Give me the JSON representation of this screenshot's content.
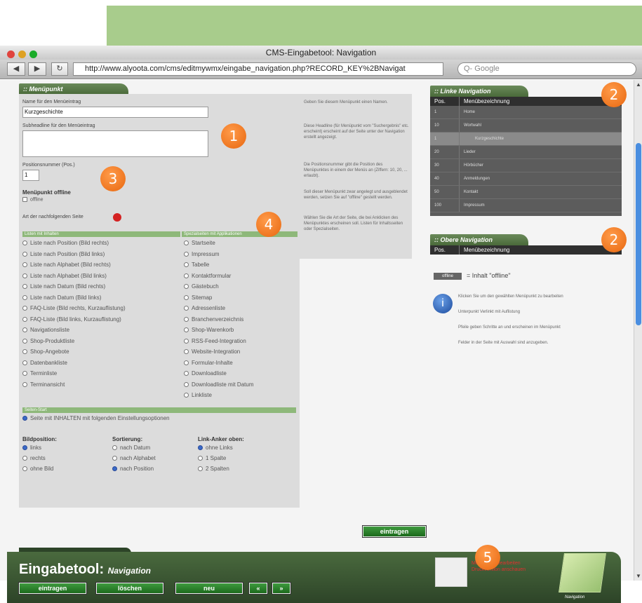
{
  "window": {
    "title": "CMS-Eingabetool: Navigation",
    "url": "http://www.alyoota.com/cms/editmywmx/eingabe_navigation.php?RECORD_KEY%2BNavigat",
    "search_placeholder": "Q- Google"
  },
  "main": {
    "tab": ":: Menüpunkt",
    "name_label": "Name für den Menüeintrag",
    "name_value": "Kurzgeschichte",
    "name_help": "Geben Sie diesem Menüpunkt einen Namen.",
    "sub_label": "Subheadline für den Menüeintrag",
    "sub_help": "Diese Headline (für Menüpunkt vom \"Suchergebnis\" etc. erscheint) erscheint auf der Seite unter der Navigation erstellt angezeigt.",
    "pos_label": "Positionsnummer (Pos.)",
    "pos_value": "1",
    "pos_help": "Die Positionsnummer gibt die Position des Menüpunktes in einem der Menüs an (Ziffern: 10, 20, ... erlaubt).",
    "offline_label": "Menüpunkt offline",
    "offline_check": "offline",
    "offline_help": "Soll dieser Menüpunkt zwar angelegt und ausgeblendet werden, setzen Sie auf \"offline\" gestellt werden.",
    "art_label": "Art der nachfolgenden Seite",
    "art_help": "Wählen Sie die Art der Seite, die bei Anklicken des Menüpunktes erscheinen soll. Listen für Inhaltsseiten oder Spezialseiten.",
    "col1_head": "Listen mit Inhalten",
    "col2_head": "Spezialseiten mit Applikationen",
    "col1": [
      "Liste nach Position (Bild rechts)",
      "Liste nach Position (Bild links)",
      "Liste nach Alphabet (Bild rechts)",
      "Liste nach Alphabet (Bild links)",
      "Liste nach Datum (Bild rechts)",
      "Liste nach Datum (Bild links)",
      "FAQ-Liste (Bild rechts, Kurzauflistung)",
      "FAQ-Liste (Bild links, Kurzauflistung)",
      "Navigationsliste",
      "Shop-Produktliste",
      "Shop-Angebote",
      "Datenbankliste",
      "Terminliste",
      "Terminansicht"
    ],
    "col2": [
      "Startseite",
      "Impressum",
      "Tabelle",
      "Kontaktformular",
      "Gästebuch",
      "Sitemap",
      "Adressenliste",
      "Branchenverzeichnis",
      "Shop-Warenkorb",
      "RSS-Feed-Integration",
      "Website-Integration",
      "Formular-Inhalte",
      "Downloadliste",
      "Downloadliste mit Datum",
      "Linkliste"
    ],
    "page_type_head": "Seiten-Start",
    "page_type_option": "Seite mit INHALTEN mit folgenden Einstellungsoptionen",
    "bild_head": "Bildposition:",
    "bild_opts": [
      "links",
      "rechts",
      "ohne Bild"
    ],
    "sort_head": "Sortierung:",
    "sort_opts": [
      "nach Datum",
      "nach Alphabet",
      "nach Position"
    ],
    "link_head": "Link-Anker oben:",
    "link_opts": [
      "ohne Links",
      "1 Spalte",
      "2 Spalten"
    ],
    "submit": "eintragen"
  },
  "left_nav": {
    "title": ":: Linke Navigation",
    "col_pos": "Pos.",
    "col_name": "Menübezeichnung",
    "rows": [
      {
        "pos": "1",
        "name": "Home"
      },
      {
        "pos": "10",
        "name": "Wortwahl"
      },
      {
        "pos": "1",
        "name": "Kurzgeschichte"
      },
      {
        "pos": "20",
        "name": "Lieder"
      },
      {
        "pos": "30",
        "name": "Hörbücher"
      },
      {
        "pos": "40",
        "name": "Anmeldungen"
      },
      {
        "pos": "50",
        "name": "Kontakt"
      },
      {
        "pos": "100",
        "name": "Impressum"
      }
    ]
  },
  "top_nav": {
    "title": ":: Obere Navigation",
    "col_pos": "Pos.",
    "col_name": "Menübezeichnung"
  },
  "legend": {
    "offline_badge": "offline",
    "offline_text": "= Inhalt \"offline\"",
    "lines": [
      "Klicken Sie um den gewählten Menüpunkt zu bearbeiten",
      "Unterpunkt Verlinkt mit Auflistung",
      "Pfeile geben Schritte an und erscheinen im Menüpunkt",
      "Felder in der Seite mit Auswahl sind anzugeben."
    ]
  },
  "footer": {
    "title": "Eingabetool:",
    "subtitle": "Navigation",
    "btn_save": "eintragen",
    "btn_delete": "löschen",
    "btn_new": "neu",
    "btn_prev": "«",
    "btn_next": "»",
    "links": [
      "Menüpunkt bearbeiten",
      "Druckversion anschauen"
    ],
    "corner_label": "Navigation"
  },
  "annotations": [
    "1",
    "2",
    "3",
    "2",
    "4",
    "5"
  ],
  "colors": {
    "accent": "#4a6a3a",
    "badge": "#e8670f",
    "sidebar": "#5c5c5c"
  }
}
